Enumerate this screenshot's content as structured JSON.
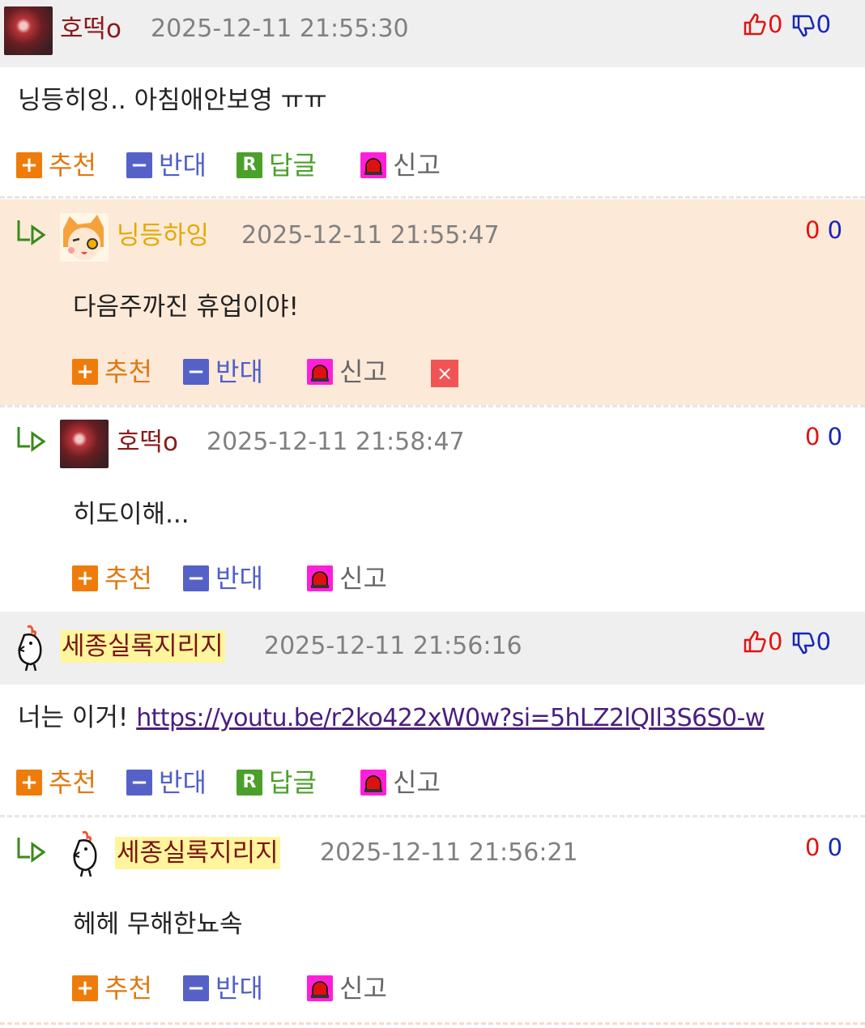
{
  "icons": {
    "thumb_up": "thumb-up-icon",
    "thumb_down": "thumb-down-icon",
    "reply_arrow": "reply-arrow-icon",
    "siren": "siren-icon",
    "delete": "close-icon",
    "avatar": "avatar"
  },
  "colors": {
    "up": "#e21212",
    "down": "#1626b8",
    "recommend": "#e07810",
    "oppose": "#4f5fc9",
    "reply": "#4ba02a",
    "report_icon": "#ff1fd8",
    "highlight": "#fde9d8"
  },
  "labels": {
    "recommend": "추천",
    "oppose": "반대",
    "reply": "답글",
    "report": "신고",
    "plus": "+",
    "minus": "−",
    "r": "R",
    "x": "×"
  },
  "comments": [
    {
      "nick": "호떡o",
      "date": "2025-12-11 21:55:30",
      "up": "0",
      "down": "0",
      "text": "닝등히잉.. 아침애안보영 ㅠㅠ"
    },
    {
      "nick": "닝등하잉",
      "date": "2025-12-11 21:55:47",
      "up": "0",
      "down": "0",
      "text": "다음주까진 휴업이야!"
    },
    {
      "nick": "호떡o",
      "date": "2025-12-11 21:58:47",
      "up": "0",
      "down": "0",
      "text": "히도이해..."
    },
    {
      "nick": "세종실록지리지",
      "date": "2025-12-11 21:56:16",
      "up": "0",
      "down": "0",
      "text_prefix": "너는 이거! ",
      "link": "https://youtu.be/r2ko422xW0w?si=5hLZ2lQIl3S6S0-w"
    },
    {
      "nick": "세종실록지리지",
      "date": "2025-12-11 21:56:21",
      "up": "0",
      "down": "0",
      "text": "헤헤 무해한뇨속"
    }
  ]
}
